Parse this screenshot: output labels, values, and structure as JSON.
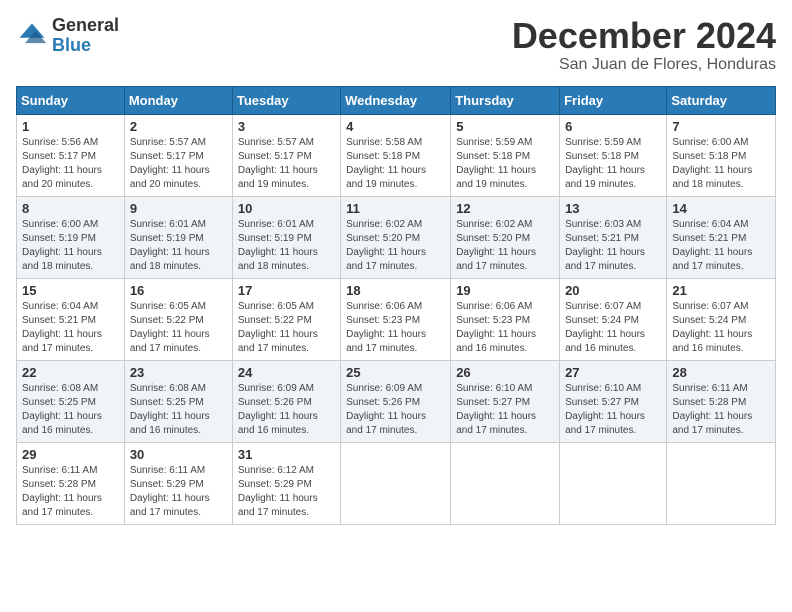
{
  "logo": {
    "general": "General",
    "blue": "Blue"
  },
  "title": "December 2024",
  "location": "San Juan de Flores, Honduras",
  "days_of_week": [
    "Sunday",
    "Monday",
    "Tuesday",
    "Wednesday",
    "Thursday",
    "Friday",
    "Saturday"
  ],
  "weeks": [
    [
      {
        "day": "1",
        "sunrise": "5:56 AM",
        "sunset": "5:17 PM",
        "daylight": "11 hours and 20 minutes."
      },
      {
        "day": "2",
        "sunrise": "5:57 AM",
        "sunset": "5:17 PM",
        "daylight": "11 hours and 20 minutes."
      },
      {
        "day": "3",
        "sunrise": "5:57 AM",
        "sunset": "5:17 PM",
        "daylight": "11 hours and 19 minutes."
      },
      {
        "day": "4",
        "sunrise": "5:58 AM",
        "sunset": "5:18 PM",
        "daylight": "11 hours and 19 minutes."
      },
      {
        "day": "5",
        "sunrise": "5:59 AM",
        "sunset": "5:18 PM",
        "daylight": "11 hours and 19 minutes."
      },
      {
        "day": "6",
        "sunrise": "5:59 AM",
        "sunset": "5:18 PM",
        "daylight": "11 hours and 19 minutes."
      },
      {
        "day": "7",
        "sunrise": "6:00 AM",
        "sunset": "5:18 PM",
        "daylight": "11 hours and 18 minutes."
      }
    ],
    [
      {
        "day": "8",
        "sunrise": "6:00 AM",
        "sunset": "5:19 PM",
        "daylight": "11 hours and 18 minutes."
      },
      {
        "day": "9",
        "sunrise": "6:01 AM",
        "sunset": "5:19 PM",
        "daylight": "11 hours and 18 minutes."
      },
      {
        "day": "10",
        "sunrise": "6:01 AM",
        "sunset": "5:19 PM",
        "daylight": "11 hours and 18 minutes."
      },
      {
        "day": "11",
        "sunrise": "6:02 AM",
        "sunset": "5:20 PM",
        "daylight": "11 hours and 17 minutes."
      },
      {
        "day": "12",
        "sunrise": "6:02 AM",
        "sunset": "5:20 PM",
        "daylight": "11 hours and 17 minutes."
      },
      {
        "day": "13",
        "sunrise": "6:03 AM",
        "sunset": "5:21 PM",
        "daylight": "11 hours and 17 minutes."
      },
      {
        "day": "14",
        "sunrise": "6:04 AM",
        "sunset": "5:21 PM",
        "daylight": "11 hours and 17 minutes."
      }
    ],
    [
      {
        "day": "15",
        "sunrise": "6:04 AM",
        "sunset": "5:21 PM",
        "daylight": "11 hours and 17 minutes."
      },
      {
        "day": "16",
        "sunrise": "6:05 AM",
        "sunset": "5:22 PM",
        "daylight": "11 hours and 17 minutes."
      },
      {
        "day": "17",
        "sunrise": "6:05 AM",
        "sunset": "5:22 PM",
        "daylight": "11 hours and 17 minutes."
      },
      {
        "day": "18",
        "sunrise": "6:06 AM",
        "sunset": "5:23 PM",
        "daylight": "11 hours and 17 minutes."
      },
      {
        "day": "19",
        "sunrise": "6:06 AM",
        "sunset": "5:23 PM",
        "daylight": "11 hours and 16 minutes."
      },
      {
        "day": "20",
        "sunrise": "6:07 AM",
        "sunset": "5:24 PM",
        "daylight": "11 hours and 16 minutes."
      },
      {
        "day": "21",
        "sunrise": "6:07 AM",
        "sunset": "5:24 PM",
        "daylight": "11 hours and 16 minutes."
      }
    ],
    [
      {
        "day": "22",
        "sunrise": "6:08 AM",
        "sunset": "5:25 PM",
        "daylight": "11 hours and 16 minutes."
      },
      {
        "day": "23",
        "sunrise": "6:08 AM",
        "sunset": "5:25 PM",
        "daylight": "11 hours and 16 minutes."
      },
      {
        "day": "24",
        "sunrise": "6:09 AM",
        "sunset": "5:26 PM",
        "daylight": "11 hours and 16 minutes."
      },
      {
        "day": "25",
        "sunrise": "6:09 AM",
        "sunset": "5:26 PM",
        "daylight": "11 hours and 17 minutes."
      },
      {
        "day": "26",
        "sunrise": "6:10 AM",
        "sunset": "5:27 PM",
        "daylight": "11 hours and 17 minutes."
      },
      {
        "day": "27",
        "sunrise": "6:10 AM",
        "sunset": "5:27 PM",
        "daylight": "11 hours and 17 minutes."
      },
      {
        "day": "28",
        "sunrise": "6:11 AM",
        "sunset": "5:28 PM",
        "daylight": "11 hours and 17 minutes."
      }
    ],
    [
      {
        "day": "29",
        "sunrise": "6:11 AM",
        "sunset": "5:28 PM",
        "daylight": "11 hours and 17 minutes."
      },
      {
        "day": "30",
        "sunrise": "6:11 AM",
        "sunset": "5:29 PM",
        "daylight": "11 hours and 17 minutes."
      },
      {
        "day": "31",
        "sunrise": "6:12 AM",
        "sunset": "5:29 PM",
        "daylight": "11 hours and 17 minutes."
      },
      null,
      null,
      null,
      null
    ]
  ],
  "labels": {
    "sunrise": "Sunrise:",
    "sunset": "Sunset:",
    "daylight": "Daylight:"
  }
}
